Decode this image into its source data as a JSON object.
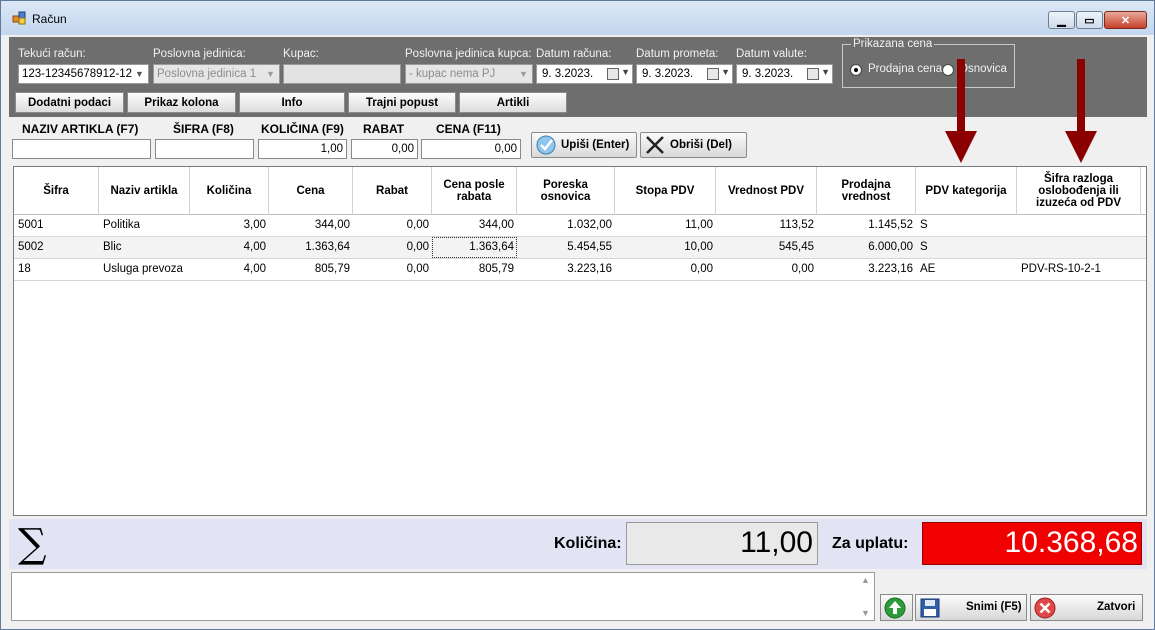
{
  "window": {
    "title": "Račun"
  },
  "header": {
    "tekuci_racun": {
      "label": "Tekući račun:",
      "value": "123-12345678912-12"
    },
    "poslovna_jedinica": {
      "label": "Poslovna jedinica:",
      "value": "Poslovna jedinica 1"
    },
    "kupac": {
      "label": "Kupac:",
      "value": ""
    },
    "pj_kupca": {
      "label": "Poslovna jedinica kupca:",
      "value": "- kupac nema PJ"
    },
    "datum_racuna": {
      "label": "Datum računa:",
      "value": "9.  3.2023."
    },
    "datum_prometa": {
      "label": "Datum prometa:",
      "value": "9.  3.2023."
    },
    "datum_valute": {
      "label": "Datum valute:",
      "value": "9.  3.2023."
    },
    "prikazana_cena": {
      "title": "Prikazana cena",
      "options": [
        "Prodajna cena",
        "Osnovica"
      ],
      "selected": "Prodajna cena"
    },
    "buttons": [
      "Dodatni podaci",
      "Prikaz kolona",
      "Info",
      "Trajni popust",
      "Artikli"
    ]
  },
  "entry": {
    "labels": [
      "NAZIV ARTIKLA (F7)",
      "ŠIFRA (F8)",
      "KOLIČINA (F9)",
      "RABAT",
      "CENA (F11)"
    ],
    "values": [
      "",
      "",
      "1,00",
      "0,00",
      "0,00"
    ],
    "upisi_label": "Upiši (Enter)",
    "obrisi_label": "Obriši (Del)"
  },
  "table": {
    "headers": [
      "Šifra",
      "Naziv artikla",
      "Količina",
      "Cena",
      "Rabat",
      "Cena posle rabata",
      "Poreska osnovica",
      "Stopa PDV",
      "Vrednost PDV",
      "Prodajna vrednost",
      "PDV kategorija",
      "Šifra razloga oslobođenja ili izuzeća od PDV"
    ],
    "rows": [
      [
        "5001",
        "Politika",
        "3,00",
        "344,00",
        "0,00",
        "344,00",
        "1.032,00",
        "11,00",
        "113,52",
        "1.145,52",
        "S",
        ""
      ],
      [
        "5002",
        "Blic",
        "4,00",
        "1.363,64",
        "0,00",
        "1.363,64",
        "5.454,55",
        "10,00",
        "545,45",
        "6.000,00",
        "S",
        ""
      ],
      [
        "18",
        "Usluga prevoza",
        "4,00",
        "805,79",
        "0,00",
        "805,79",
        "3.223,16",
        "0,00",
        "0,00",
        "3.223,16",
        "AE",
        "PDV-RS-10-2-1"
      ]
    ]
  },
  "summary": {
    "kolicina_label": "Količina:",
    "kolicina_value": "11,00",
    "za_uplatu_label": "Za uplatu:",
    "za_uplatu_value": "10.368,68"
  },
  "footer": {
    "snimi_label": "Snimi (F5)",
    "zatvori_label": "Zatvori"
  },
  "colors": {
    "panel": "#6e6e6e",
    "summary_bg": "#e2e4f4",
    "pay_bg": "#f00000",
    "annotation_arrow": "#8b0000"
  },
  "icons": [
    "app-icon",
    "minimize-icon",
    "maximize-icon",
    "close-icon",
    "dropdown-arrow-icon",
    "calendar-icon",
    "checkmark-icon",
    "x-delete-icon",
    "sigma-icon",
    "green-up-arrow-icon",
    "floppy-save-icon",
    "red-close-icon",
    "red-down-arrow-icon"
  ]
}
